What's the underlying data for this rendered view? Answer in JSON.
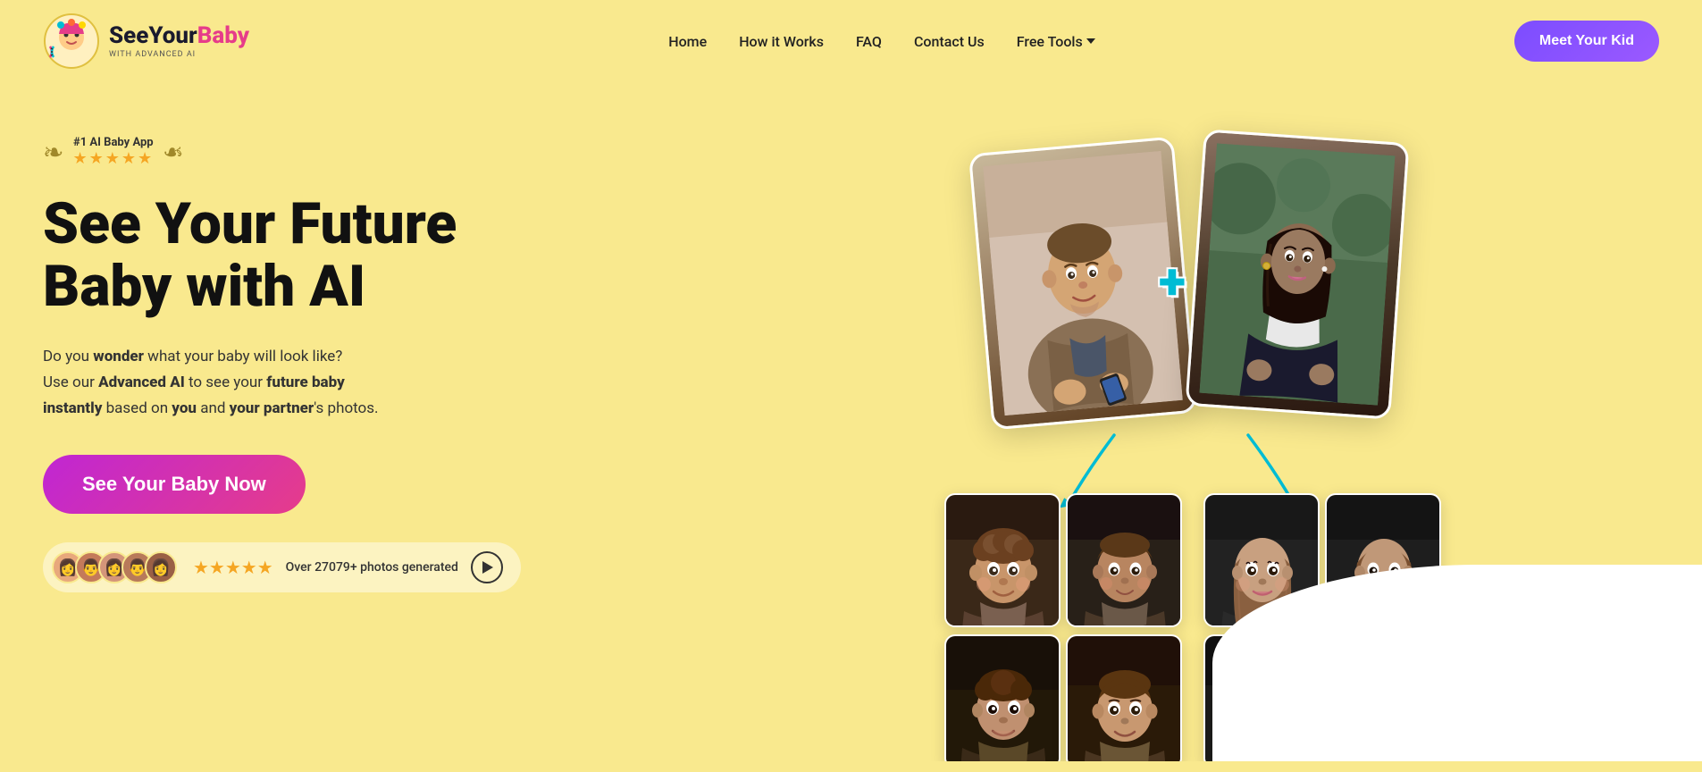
{
  "brand": {
    "name_see": "See",
    "name_your": "Your",
    "name_baby": "Baby",
    "subtitle": "WITH ADVANCED AI"
  },
  "nav": {
    "home": "Home",
    "how_it_works": "How it Works",
    "faq": "FAQ",
    "contact_us": "Contact Us",
    "free_tools": "Free Tools",
    "meet_btn": "Meet Your Kid"
  },
  "hero": {
    "award_label": "#1 AI Baby App",
    "stars": "★★★★★",
    "heading_line1": "See Your Future",
    "heading_line2": "Baby with AI",
    "desc_part1": "Do you ",
    "desc_wonder": "wonder",
    "desc_part2": " what your baby will look like?",
    "desc_part3": "Use our ",
    "desc_advanced_ai": "Advanced AI",
    "desc_part4": " to see your ",
    "desc_future_baby": "future baby",
    "desc_part5": " ",
    "desc_instantly": "instantly",
    "desc_part6": " based on ",
    "desc_you": "you",
    "desc_part7": " and ",
    "desc_your_partner": "your partner",
    "desc_part8": "'s photos.",
    "cta": "See Your Baby Now",
    "proof_photos_count": 5,
    "proof_stars": "★★★★★",
    "proof_text": "Over 27079+ photos generated",
    "plus_sign": "+"
  },
  "colors": {
    "bg": "#f9e98e",
    "cta_gradient_from": "#c026d3",
    "cta_gradient_to": "#e63c8a",
    "meet_btn_from": "#7c4dff",
    "meet_btn_to": "#9b59ff",
    "plus_color": "#00bcd4",
    "arrow_color": "#00bcd4"
  }
}
